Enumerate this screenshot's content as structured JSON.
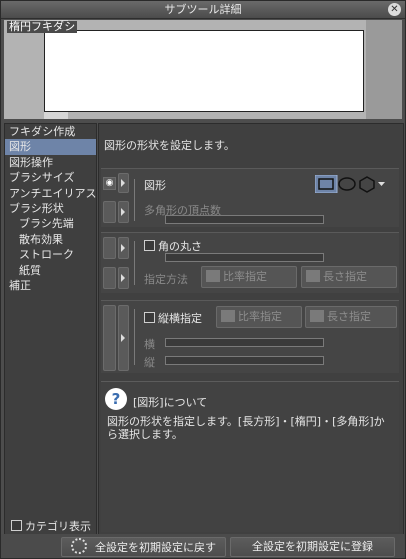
{
  "window": {
    "title": "サブツール詳細",
    "close_glyph": "✕"
  },
  "preview": {
    "label": "楕円フキダシ"
  },
  "sidebar": {
    "items": [
      {
        "label": "フキダシ作成"
      },
      {
        "label": "図形"
      },
      {
        "label": "図形操作"
      },
      {
        "label": "ブラシサイズ"
      },
      {
        "label": "アンチエイリアス"
      },
      {
        "label": "ブラシ形状"
      },
      {
        "label": "ブラシ先端"
      },
      {
        "label": "散布効果"
      },
      {
        "label": "ストローク"
      },
      {
        "label": "紙質"
      },
      {
        "label": "補正"
      }
    ],
    "category_display_label": "カテゴリ表示"
  },
  "main": {
    "description": "図形の形状を設定します。",
    "shape": {
      "label": "図形",
      "polygon_vertices_label": "多角形の頂点数",
      "options": [
        "rectangle",
        "ellipse",
        "polygon"
      ],
      "selected": "rectangle"
    },
    "rounded": {
      "label": "角の丸さ",
      "method_label": "指定方法",
      "ratio_button": "比率指定",
      "length_button": "長さ指定"
    },
    "aspect": {
      "label": "縦横指定",
      "ratio_button": "比率指定",
      "length_button": "長さ指定",
      "width_label": "横",
      "height_label": "縦"
    }
  },
  "help": {
    "icon_glyph": "?",
    "title": "[図形]について",
    "text": "図形の形状を指定します。[長方形]・[楕円]・[多角形]から選択します。"
  },
  "bottom": {
    "reset_button": "全設定を初期設定に戻す",
    "register_button": "全設定を初期設定に登録"
  },
  "colors": {
    "accent_selected": "#6e84a8",
    "background": "#4a4a4a"
  }
}
